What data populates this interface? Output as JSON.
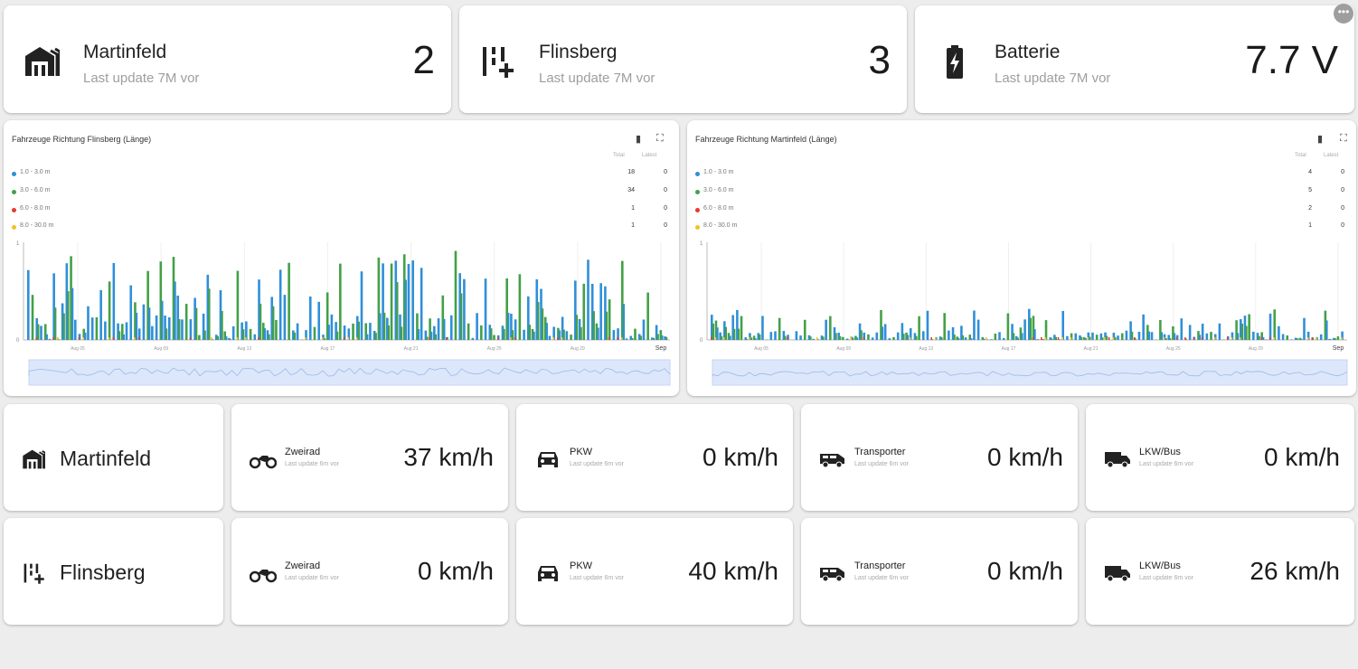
{
  "tiles": [
    {
      "title": "Martinfeld",
      "subtitle": "Last update 7M vor",
      "value": "2",
      "icon": "garage-icon"
    },
    {
      "title": "Flinsberg",
      "subtitle": "Last update 7M vor",
      "value": "3",
      "icon": "lanes-plus-icon"
    },
    {
      "title": "Batterie",
      "subtitle": "Last update 7M vor",
      "value": "7.7 V",
      "icon": "battery-charging-icon"
    }
  ],
  "charts": [
    {
      "title": "Fahrzeuge Richtung Flinsberg (Länge)",
      "legend_headers": {
        "total": "Total",
        "latest": "Latest"
      },
      "legend": [
        {
          "label": "1.0 - 3.0 m",
          "total": "18",
          "latest": "0",
          "color": "#2f8fd8"
        },
        {
          "label": "3.0 - 6.0 m",
          "total": "34",
          "latest": "0",
          "color": "#43a047"
        },
        {
          "label": "6.0 - 8.0 m",
          "total": "1",
          "latest": "0",
          "color": "#e53935"
        },
        {
          "label": "8.0 - 30.0 m",
          "total": "1",
          "latest": "0",
          "color": "#f6bf26"
        }
      ],
      "x_ticks": [
        "Aug 05",
        "Aug 09",
        "Aug 13",
        "Aug 17",
        "Aug 21",
        "Aug 25",
        "Aug 29",
        "Sep"
      ],
      "y_ticks": [
        "1",
        "0"
      ]
    },
    {
      "title": "Fahrzeuge Richtung Martinfeld (Länge)",
      "legend_headers": {
        "total": "Total",
        "latest": "Latest"
      },
      "legend": [
        {
          "label": "1.0 - 3.0 m",
          "total": "4",
          "latest": "0",
          "color": "#2f8fd8"
        },
        {
          "label": "3.0 - 6.0 m",
          "total": "5",
          "latest": "0",
          "color": "#43a047"
        },
        {
          "label": "6.0 - 8.0 m",
          "total": "2",
          "latest": "0",
          "color": "#e53935"
        },
        {
          "label": "8.0 - 30.0 m",
          "total": "1",
          "latest": "0",
          "color": "#f6bf26"
        }
      ],
      "x_ticks": [
        "Aug 05",
        "Aug 09",
        "Aug 13",
        "Aug 17",
        "Aug 21",
        "Aug 25",
        "Aug 29",
        "Sep"
      ],
      "y_ticks": [
        "1",
        "0"
      ]
    }
  ],
  "speed_rows": [
    {
      "location": "Martinfeld",
      "location_icon": "garage-icon",
      "items": [
        {
          "title": "Zweirad",
          "subtitle": "Last update 6m vor",
          "value": "37 km/h",
          "icon": "motorbike-icon"
        },
        {
          "title": "PKW",
          "subtitle": "Last update 6m vor",
          "value": "0 km/h",
          "icon": "car-icon"
        },
        {
          "title": "Transporter",
          "subtitle": "Last update 6m vor",
          "value": "0 km/h",
          "icon": "van-icon"
        },
        {
          "title": "LKW/Bus",
          "subtitle": "Last update 6m vor",
          "value": "0 km/h",
          "icon": "truck-icon"
        }
      ]
    },
    {
      "location": "Flinsberg",
      "location_icon": "lanes-plus-icon",
      "items": [
        {
          "title": "Zweirad",
          "subtitle": "Last update 6m vor",
          "value": "0 km/h",
          "icon": "motorbike-icon"
        },
        {
          "title": "PKW",
          "subtitle": "Last update 6m vor",
          "value": "40 km/h",
          "icon": "car-icon"
        },
        {
          "title": "Transporter",
          "subtitle": "Last update 6m vor",
          "value": "0 km/h",
          "icon": "van-icon"
        },
        {
          "title": "LKW/Bus",
          "subtitle": "Last update 6m vor",
          "value": "26 km/h",
          "icon": "truck-icon"
        }
      ]
    }
  ]
}
